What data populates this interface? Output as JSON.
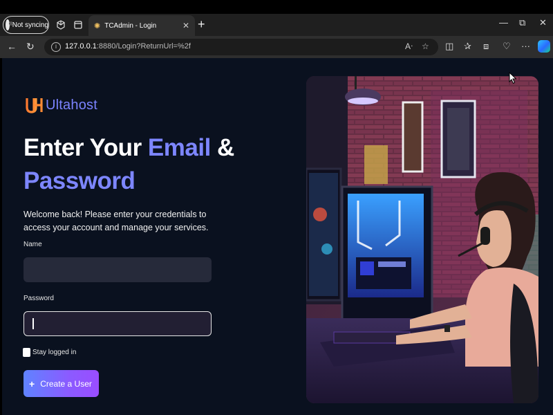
{
  "browser": {
    "profile_label": "Not syncing",
    "tab_title": "TCAdmin - Login",
    "url_host": "127.0.0.1",
    "url_rest": ":8880/Login?ReturnUrl=%2f"
  },
  "page": {
    "logo_text": "Ultahost",
    "heading_part1": "Enter Your ",
    "heading_accent1": "Email",
    "heading_part2": " &",
    "heading_accent2": "Password",
    "welcome_text": "Welcome back! Please enter your credentials to access your account and manage your services.",
    "name_label": "Name",
    "name_value": "",
    "password_label": "Password",
    "password_value": "",
    "stay_logged_in": "Stay logged in",
    "create_user_button": "Create a User"
  },
  "colors": {
    "page_bg": "#0a111f",
    "accent": "#7d86ff",
    "input_bg": "#262a3a",
    "button_start": "#5f83ff",
    "button_end": "#9a4dff"
  },
  "icons": [
    "profile-avatar-icon",
    "workspaces-icon",
    "tab-actions-icon",
    "favicon-icon",
    "close-tab-icon",
    "new-tab-icon",
    "minimize-icon",
    "restore-icon",
    "close-window-icon",
    "back-icon",
    "reload-icon",
    "site-info-icon",
    "read-aloud-icon",
    "favorite-icon",
    "split-screen-icon",
    "favorites-icon",
    "collections-icon",
    "browser-essentials-icon",
    "more-icon",
    "copilot-icon",
    "plus-icon",
    "mouse-cursor-icon"
  ]
}
